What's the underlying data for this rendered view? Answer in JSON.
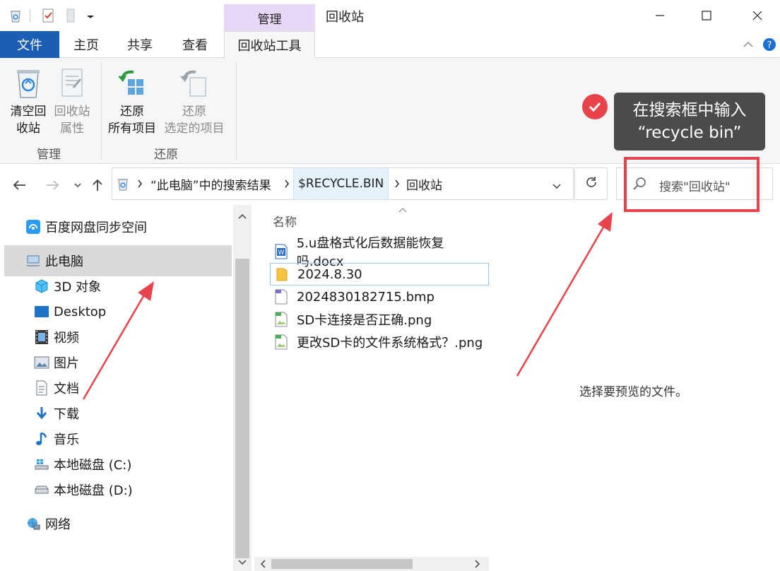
{
  "window": {
    "title": "回收站",
    "context_tab": "管理"
  },
  "tabs": {
    "file": "文件",
    "home": "主页",
    "share": "共享",
    "view": "查看",
    "recycle_tools": "回收站工具"
  },
  "ribbon": {
    "empty_line1": "清空回",
    "empty_line2": "收站",
    "props_line1": "回收站",
    "props_line2": "属性",
    "group_manage": "管理",
    "restore_all_line1": "还原",
    "restore_all_line2": "所有项目",
    "restore_sel_line1": "还原",
    "restore_sel_line2": "选定的项目",
    "group_restore": "还原"
  },
  "annotation": {
    "tip_line1": "在搜索框中输入",
    "tip_line2": "“recycle bin”",
    "accent_color": "#e8424a"
  },
  "address": {
    "crumb1": "“此电脑”中的搜索结果",
    "crumb2": "$RECYCLE.BIN",
    "crumb3": "回收站"
  },
  "search": {
    "placeholder": "搜索\"回收站\""
  },
  "navpane": {
    "baidu": "百度网盘同步空间",
    "this_pc": "此电脑",
    "objects3d": "3D 对象",
    "desktop": "Desktop",
    "videos": "视频",
    "pictures": "图片",
    "documents": "文档",
    "downloads": "下载",
    "music": "音乐",
    "disk_c": "本地磁盘 (C:)",
    "disk_d": "本地磁盘 (D:)",
    "network": "网络"
  },
  "filelist": {
    "column_name": "名称",
    "files": [
      {
        "name": "5.u盘格式化后数据能恢复吗.docx",
        "icon": "word-doc-icon"
      },
      {
        "name": "2024.8.30",
        "icon": "folder-icon"
      },
      {
        "name": "2024830182715.bmp",
        "icon": "bmp-file-icon"
      },
      {
        "name": "SD卡连接是否正确.png",
        "icon": "png-file-icon"
      },
      {
        "name": "更改SD卡的文件系统格式？.png",
        "icon": "png-file-icon"
      }
    ]
  },
  "preview": {
    "empty_text": "选择要预览的文件。"
  }
}
